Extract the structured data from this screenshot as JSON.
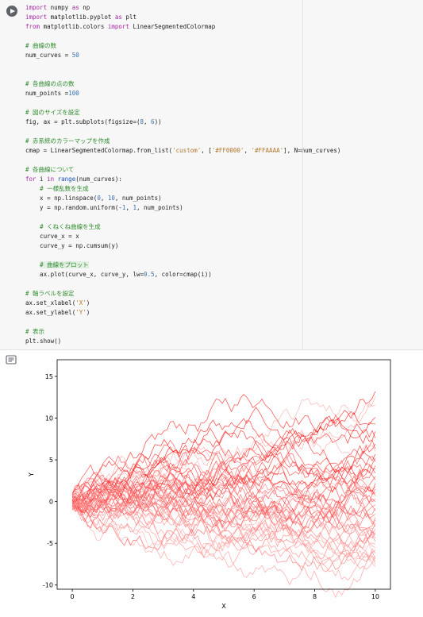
{
  "code_lines": [
    [
      {
        "t": "import",
        "c": "kw"
      },
      {
        "t": " numpy "
      },
      {
        "t": "as",
        "c": "kw"
      },
      {
        "t": " np"
      }
    ],
    [
      {
        "t": "import",
        "c": "kw"
      },
      {
        "t": " matplotlib.pyplot "
      },
      {
        "t": "as",
        "c": "kw"
      },
      {
        "t": " plt"
      }
    ],
    [
      {
        "t": "from",
        "c": "kw"
      },
      {
        "t": " matplotlib.colors "
      },
      {
        "t": "import",
        "c": "kw"
      },
      {
        "t": " LinearSegmentedColormap"
      }
    ],
    [],
    [
      {
        "t": "# 曲線の数",
        "c": "cm"
      }
    ],
    [
      {
        "t": "num_curves = "
      },
      {
        "t": "50",
        "c": "nu"
      }
    ],
    [],
    [],
    [
      {
        "t": "# 各曲線の点の数",
        "c": "cm"
      }
    ],
    [
      {
        "t": "num_points ="
      },
      {
        "t": "100",
        "c": "nu"
      }
    ],
    [],
    [
      {
        "t": "# 図のサイズを設定",
        "c": "cm"
      }
    ],
    [
      {
        "t": "fig, ax = plt.subplots(figsize=("
      },
      {
        "t": "8",
        "c": "nu"
      },
      {
        "t": ", "
      },
      {
        "t": "6",
        "c": "nu"
      },
      {
        "t": "))"
      }
    ],
    [],
    [
      {
        "t": "# 赤系統のカラーマップを作成",
        "c": "cm"
      }
    ],
    [
      {
        "t": "cmap = LinearSegmentedColormap.from_list("
      },
      {
        "t": "'custom'",
        "c": "st"
      },
      {
        "t": ", ["
      },
      {
        "t": "'#FF0000'",
        "c": "st"
      },
      {
        "t": ", "
      },
      {
        "t": "'#FFAAAA'",
        "c": "st"
      },
      {
        "t": "], N=num_curves)"
      }
    ],
    [],
    [
      {
        "t": "# 各曲線について",
        "c": "cm"
      }
    ],
    [
      {
        "t": "for",
        "c": "kw"
      },
      {
        "t": " i "
      },
      {
        "t": "in",
        "c": "kw"
      },
      {
        "t": " "
      },
      {
        "t": "range",
        "c": "fn"
      },
      {
        "t": "(num_curves):"
      }
    ],
    [
      {
        "t": "    "
      },
      {
        "t": "# 一様乱数を生成",
        "c": "cm"
      }
    ],
    [
      {
        "t": "    x = np.linspace("
      },
      {
        "t": "0",
        "c": "nu"
      },
      {
        "t": ", "
      },
      {
        "t": "10",
        "c": "nu"
      },
      {
        "t": ", num_points)"
      }
    ],
    [
      {
        "t": "    y = np.random.uniform(-"
      },
      {
        "t": "1",
        "c": "nu"
      },
      {
        "t": ", "
      },
      {
        "t": "1",
        "c": "nu"
      },
      {
        "t": ", num_points)"
      }
    ],
    [],
    [
      {
        "t": "    "
      },
      {
        "t": "# くねくね曲線を生成",
        "c": "cm"
      }
    ],
    [
      {
        "t": "    curve_x = x"
      }
    ],
    [
      {
        "t": "    curve_y = np.cumsum(y)"
      }
    ],
    [],
    [
      {
        "t": "    "
      },
      {
        "t": "# 曲線をプロット",
        "c": "cm hl"
      }
    ],
    [
      {
        "t": "    ax.plot(curve_x, curve_y, lw="
      },
      {
        "t": "0.5",
        "c": "nu"
      },
      {
        "t": ", color=cmap(i))"
      }
    ],
    [],
    [
      {
        "t": "# 軸ラベルを設定",
        "c": "cm"
      }
    ],
    [
      {
        "t": "ax.set_xlabel("
      },
      {
        "t": "'X'",
        "c": "st"
      },
      {
        "t": ")"
      }
    ],
    [
      {
        "t": "ax.set_ylabel("
      },
      {
        "t": "'Y'",
        "c": "st"
      },
      {
        "t": ")"
      }
    ],
    [],
    [
      {
        "t": "# 表示",
        "c": "cm"
      }
    ],
    [
      {
        "t": "plt.show()"
      }
    ]
  ],
  "output_icon": "output-toggle-icon",
  "chart_data": {
    "type": "line",
    "title": "",
    "xlabel": "X",
    "ylabel": "Y",
    "xlim": [
      -0.5,
      10.5
    ],
    "ylim": [
      -10.5,
      17
    ],
    "xticks": [
      0,
      2,
      4,
      6,
      8,
      10
    ],
    "yticks": [
      -10,
      -5,
      0,
      5,
      10,
      15
    ],
    "grid": false,
    "series_count": 50,
    "points_per_series": 100,
    "color_start": "#FF0000",
    "color_end": "#FFAAAA",
    "line_width": 0.5,
    "series_end_values": [
      13.2,
      10.1,
      9.3,
      8.4,
      7.6,
      6.9,
      6.3,
      5.7,
      5.2,
      4.8,
      4.3,
      3.9,
      3.4,
      3.0,
      2.6,
      2.2,
      1.8,
      1.5,
      1.1,
      0.7,
      0.3,
      0.0,
      -0.4,
      -0.8,
      -1.1,
      -1.5,
      -1.9,
      -2.2,
      -2.6,
      -3.0,
      -3.3,
      -3.7,
      -4.0,
      -4.4,
      -4.8,
      -5.1,
      -5.5,
      -5.8,
      -6.2,
      -6.5,
      -6.9,
      -7.2,
      -7.5,
      -7.8,
      11.6,
      12.6,
      -2.9,
      6.0,
      0.9,
      -6.0
    ]
  }
}
